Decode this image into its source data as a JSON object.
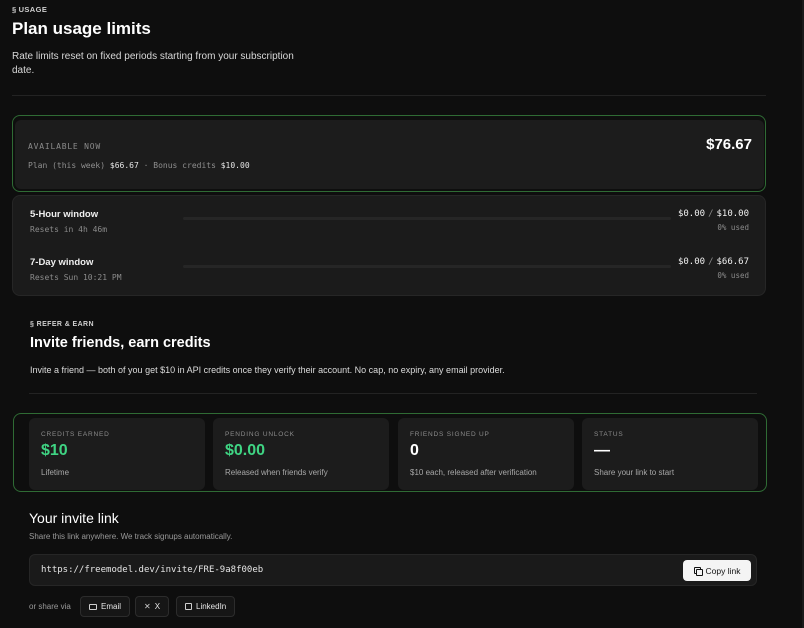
{
  "header": {
    "section_icon": "§",
    "eyebrow": "USAGE",
    "title": "Plan usage limits",
    "description": "Rate limits reset on fixed periods starting from your subscription date."
  },
  "available": {
    "label": "AVAILABLE NOW",
    "amount": "$76.67",
    "plan_label": "Plan (this week)",
    "plan_value": "$66.67",
    "separator": "·",
    "bonus_label": "Bonus credits",
    "bonus_value": "$10.00",
    "accent_color": "#2f6b34"
  },
  "windows": [
    {
      "title": "5-Hour window",
      "resets": "Resets in 4h 46m",
      "used": "$0.00",
      "separator": "/",
      "limit": "$10.00",
      "percent_text": "0% used",
      "used_fraction": 0
    },
    {
      "title": "7-Day window",
      "resets": "Resets Sun 10:21 PM",
      "used": "$0.00",
      "separator": "/",
      "limit": "$66.67",
      "percent_text": "0% used",
      "used_fraction": 0
    }
  ],
  "referral": {
    "section_icon": "§",
    "eyebrow": "REFER & EARN",
    "title": "Invite friends, earn credits",
    "description": "Invite a friend — both of you get $10 in API credits once they verify their account. No cap, no expiry, any email provider.",
    "stats": [
      {
        "label": "CREDITS EARNED",
        "value": "$10",
        "sub": "Lifetime",
        "color": "#3fd483"
      },
      {
        "label": "PENDING UNLOCK",
        "value": "$0.00",
        "sub": "Released when friends verify",
        "color": "#3fd483"
      },
      {
        "label": "FRIENDS SIGNED UP",
        "value": "0",
        "sub": "$10 each, released after verification",
        "color": "#ffffff"
      },
      {
        "label": "STATUS",
        "value": "—",
        "sub": "Share your link to start",
        "color": "#ffffff"
      }
    ]
  },
  "invite": {
    "title": "Your invite link",
    "subtitle": "Share this link anywhere. We track signups automatically.",
    "link": "https://freemodel.dev/invite/FRE-9a8f00eb",
    "copy_label": "Copy link",
    "share_label": "or share via",
    "share_buttons": [
      {
        "label": "Email",
        "icon": "mail-icon"
      },
      {
        "label": "X",
        "icon": "x-icon"
      },
      {
        "label": "LinkedIn",
        "icon": "linkedin-icon"
      }
    ]
  }
}
